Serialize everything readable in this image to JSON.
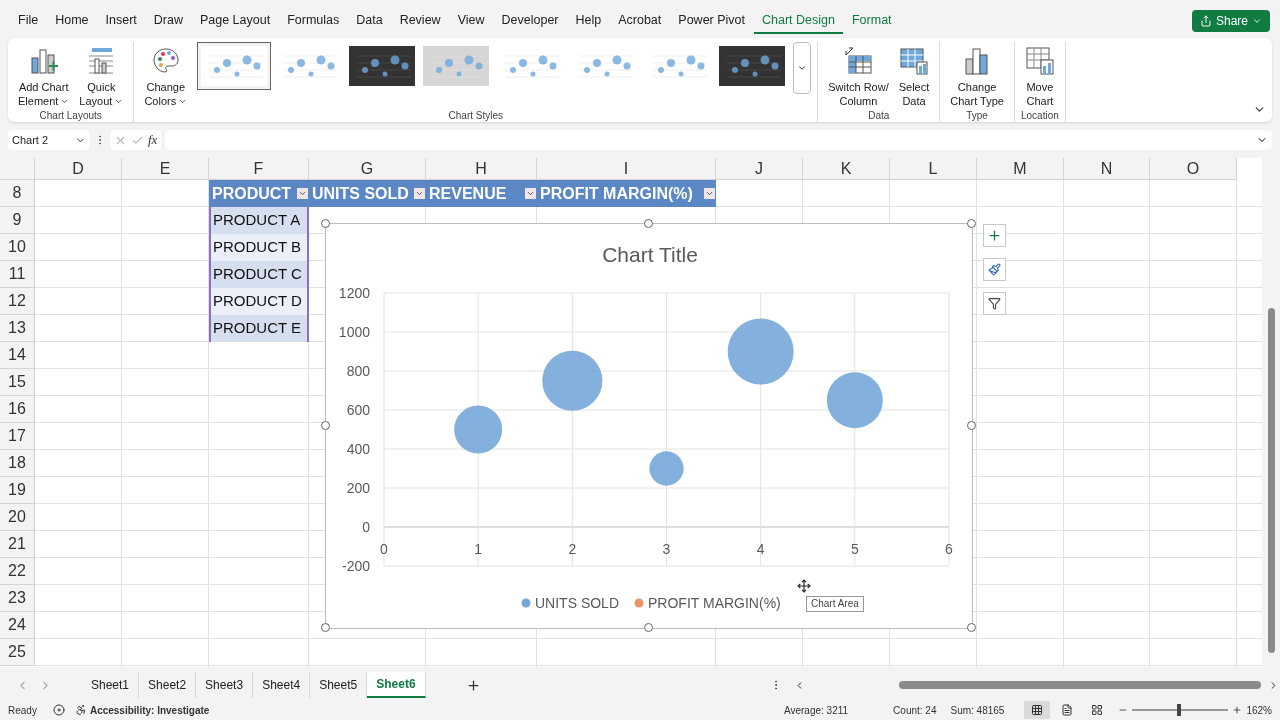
{
  "menu_tabs": [
    {
      "label": "File",
      "selected": false,
      "contextual": false
    },
    {
      "label": "Home",
      "selected": false,
      "contextual": false
    },
    {
      "label": "Insert",
      "selected": false,
      "contextual": false
    },
    {
      "label": "Draw",
      "selected": false,
      "contextual": false
    },
    {
      "label": "Page Layout",
      "selected": false,
      "contextual": false
    },
    {
      "label": "Formulas",
      "selected": false,
      "contextual": false
    },
    {
      "label": "Data",
      "selected": false,
      "contextual": false
    },
    {
      "label": "Review",
      "selected": false,
      "contextual": false
    },
    {
      "label": "View",
      "selected": false,
      "contextual": false
    },
    {
      "label": "Developer",
      "selected": false,
      "contextual": false
    },
    {
      "label": "Help",
      "selected": false,
      "contextual": false
    },
    {
      "label": "Acrobat",
      "selected": false,
      "contextual": false
    },
    {
      "label": "Power Pivot",
      "selected": false,
      "contextual": false
    },
    {
      "label": "Chart Design",
      "selected": true,
      "contextual": true
    },
    {
      "label": "Format",
      "selected": false,
      "contextual": true
    }
  ],
  "share_button": {
    "label": "Share"
  },
  "ribbon_groups": [
    {
      "label": "Chart Layouts",
      "buttons": [
        {
          "kind": "add-element",
          "lines": [
            "Add Chart",
            "Element"
          ],
          "dropdown": true
        },
        {
          "kind": "quick-layout",
          "lines": [
            "Quick",
            "Layout"
          ],
          "dropdown": true
        }
      ]
    },
    {
      "label": "Chart Styles",
      "buttons": [
        {
          "kind": "change-colors",
          "lines": [
            "Change",
            "Colors"
          ],
          "dropdown": true
        }
      ],
      "styles": [
        {
          "kind": "light",
          "selected": true
        },
        {
          "kind": "light",
          "selected": false
        },
        {
          "kind": "dark",
          "selected": false
        },
        {
          "kind": "gray",
          "selected": false
        },
        {
          "kind": "light",
          "selected": false
        },
        {
          "kind": "light",
          "selected": false
        },
        {
          "kind": "light",
          "selected": false
        },
        {
          "kind": "dark",
          "selected": false
        }
      ]
    },
    {
      "label": "Data",
      "buttons": [
        {
          "kind": "switch",
          "lines": [
            "Switch Row/",
            "Column"
          ],
          "dropdown": false
        },
        {
          "kind": "select-data",
          "lines": [
            "Select",
            "Data"
          ],
          "dropdown": false
        }
      ]
    },
    {
      "label": "Type",
      "buttons": [
        {
          "kind": "chart-type",
          "lines": [
            "Change",
            "Chart Type"
          ],
          "dropdown": false
        }
      ]
    },
    {
      "label": "Location",
      "buttons": [
        {
          "kind": "move",
          "lines": [
            "Move",
            "Chart"
          ],
          "dropdown": false
        }
      ]
    }
  ],
  "formula_bar": {
    "name_box": "Chart 2",
    "function_label": "fx"
  },
  "columns": [
    "D",
    "E",
    "F",
    "G",
    "H",
    "I",
    "J",
    "K",
    "L",
    "M",
    "N",
    "O"
  ],
  "rows": [
    "8",
    "9",
    "10",
    "11",
    "12",
    "13",
    "14",
    "15",
    "16",
    "17",
    "18",
    "19",
    "20",
    "21",
    "22",
    "23",
    "24",
    "25"
  ],
  "table": {
    "header": [
      "PRODUCT",
      "UNITS SOLD",
      "REVENUE",
      "PROFIT MARGIN(%)"
    ],
    "rows": [
      {
        "product": "PRODUCT A"
      },
      {
        "product": "PRODUCT B"
      },
      {
        "product": "PRODUCT C"
      },
      {
        "product": "PRODUCT D"
      },
      {
        "product": "PRODUCT E"
      }
    ]
  },
  "chart": {
    "title": "Chart Title",
    "tooltip": "Chart Area",
    "chart_data": {
      "type": "scatter",
      "grid": true,
      "x": [
        1,
        2,
        3,
        4,
        5
      ],
      "xlim": [
        0,
        6
      ],
      "ylim": [
        -200,
        1200
      ],
      "xticks": [
        0,
        1,
        2,
        3,
        4,
        5,
        6
      ],
      "yticks": [
        -200,
        0,
        200,
        400,
        600,
        800,
        1000,
        1200
      ],
      "series": [
        {
          "name": "UNITS SOLD",
          "color": "#75a7d8",
          "values": [
            500,
            750,
            300,
            900,
            650
          ],
          "sizes": [
            0.53,
            0.83,
            0.27,
            1,
            0.72
          ]
        },
        {
          "name": "PROFIT MARGIN(%)",
          "color": "#e8956a",
          "values": [
            null,
            null,
            null,
            null,
            null
          ]
        }
      ]
    }
  },
  "sheet_tabs": [
    {
      "label": "Sheet1",
      "selected": false
    },
    {
      "label": "Sheet2",
      "selected": false
    },
    {
      "label": "Sheet3",
      "selected": false
    },
    {
      "label": "Sheet4",
      "selected": false
    },
    {
      "label": "Sheet5",
      "selected": false
    },
    {
      "label": "Sheet6",
      "selected": true
    }
  ],
  "status_bar": {
    "ready": "Ready",
    "accessibility": "Accessibility: Investigate",
    "average": "Average: 3211",
    "count": "Count: 24",
    "sum": "Sum: 48165",
    "views": [
      {
        "kind": "normal",
        "selected": true
      },
      {
        "kind": "page-layout",
        "selected": false
      },
      {
        "kind": "page-break",
        "selected": false
      }
    ],
    "zoom": {
      "level": 0.49,
      "label": "162%"
    }
  }
}
